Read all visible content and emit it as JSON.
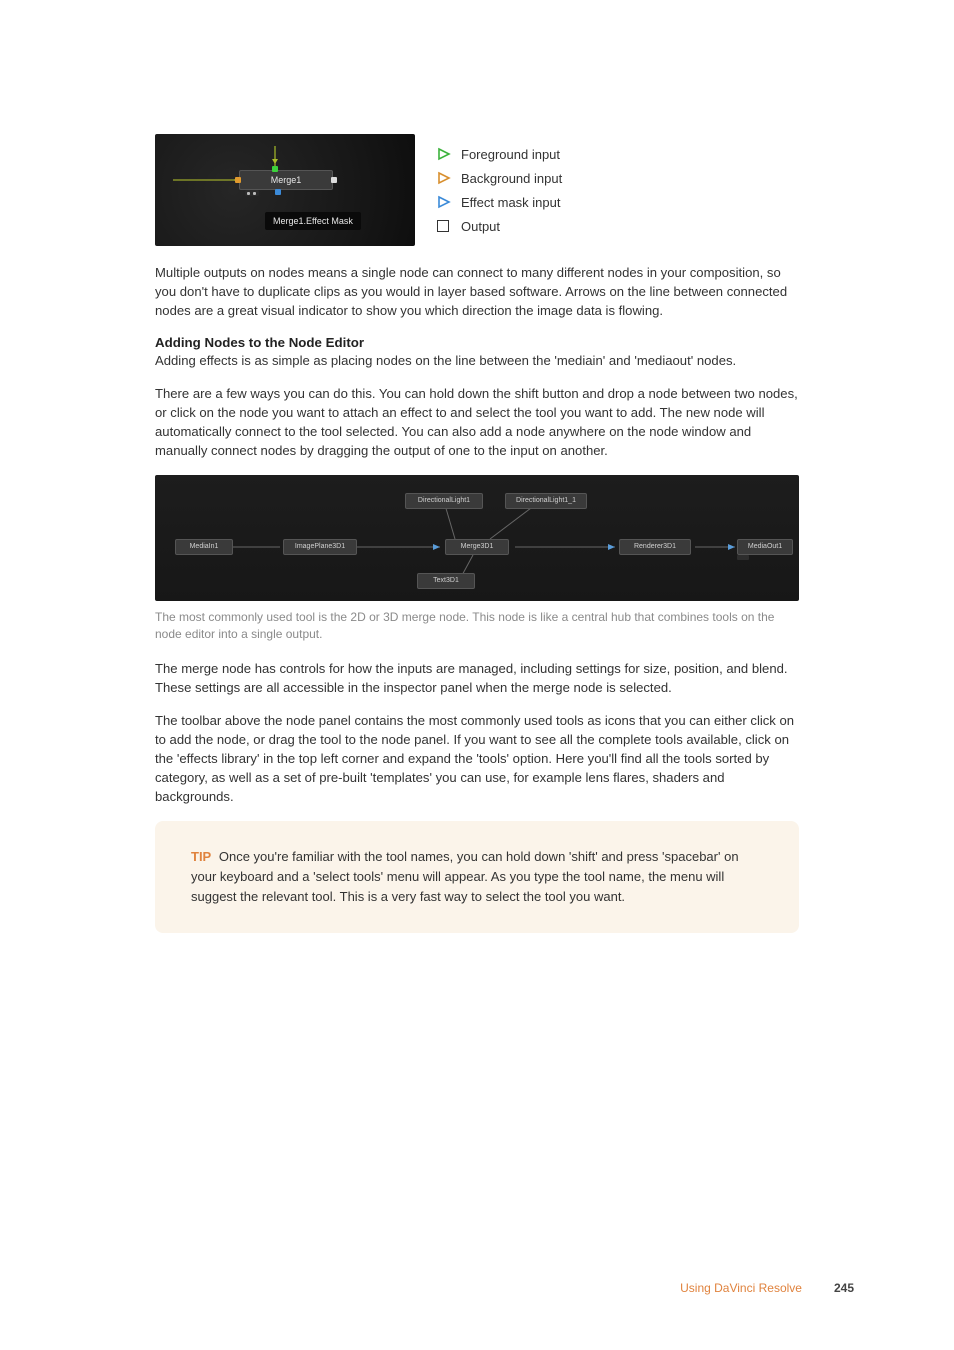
{
  "figure1": {
    "merge_label": "Merge1",
    "tooltip": "Merge1.Effect Mask",
    "legend": [
      {
        "kind": "tri-green",
        "label": "Foreground input"
      },
      {
        "kind": "tri-orange",
        "label": "Background input"
      },
      {
        "kind": "tri-blue",
        "label": "Effect mask input"
      },
      {
        "kind": "square",
        "label": "Output"
      }
    ]
  },
  "para1": "Multiple outputs on nodes means a single node can connect to many different nodes in your composition, so you don't have to duplicate clips as you would in layer based software. Arrows on the line between connected nodes are a great visual indicator to show you which direction the image data is flowing.",
  "heading1": "Adding Nodes to the Node Editor",
  "para2": "Adding effects is as simple as placing nodes on the line between the 'mediain' and 'mediaout' nodes.",
  "para3": "There are a few ways you can do this. You can hold down the shift button and drop a node between two nodes, or click on the node you want to attach an effect to and select the tool you want to add. The new node will automatically connect to the tool selected. You can also add a node anywhere on the node window and manually connect nodes by dragging the output of one to the input on another.",
  "figure2": {
    "nodes": {
      "dl1": "DirectionalLight1",
      "dl2": "DirectionalLight1_1",
      "mediain": "MediaIn1",
      "imgplane": "ImagePlane3D1",
      "merge3d": "Merge3D1",
      "text3d": "Text3D1",
      "renderer": "Renderer3D1",
      "mediaout": "MediaOut1"
    }
  },
  "caption1": "The most commonly used tool is the 2D or 3D merge node. This node is like a central hub that combines tools on the node editor into a single output.",
  "para4": "The merge node has controls for how the inputs are managed, including settings for size, position, and blend. These settings are all accessible in the inspector panel when the merge node is selected.",
  "para5": "The toolbar above the node panel contains the most commonly used tools as icons that you can either click on to add the node, or drag the tool to the node panel. If you want to see all the complete tools available, click on the 'effects library' in the top left corner and expand the 'tools' option. Here you'll find all the tools sorted by category, as well as a set of pre-built 'templates' you can use, for example lens flares, shaders and backgrounds.",
  "tip": {
    "label": "TIP",
    "text": "Once you're familiar with the tool names, you can hold down 'shift' and press 'spacebar' on your keyboard and a 'select tools' menu will appear. As you type the tool name, the menu will suggest the relevant tool. This is a very fast way to select the tool you want."
  },
  "footer": {
    "section": "Using DaVinci Resolve",
    "page": "245"
  }
}
